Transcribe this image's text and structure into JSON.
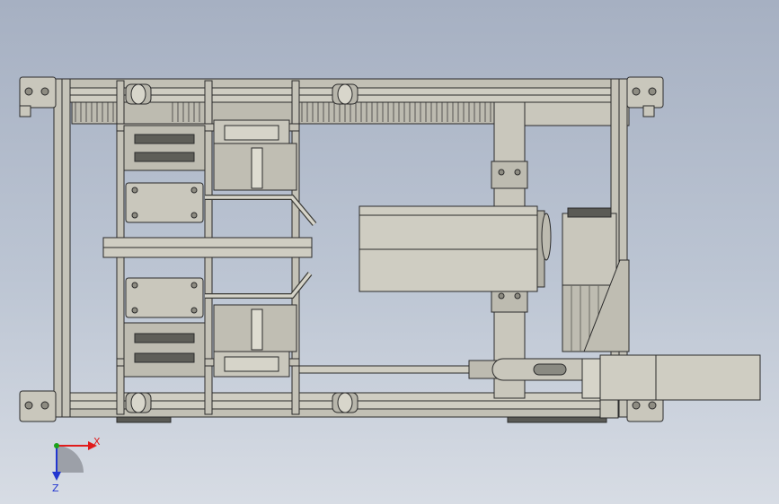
{
  "colors": {
    "background_top": "#a6b0c2",
    "background_bottom": "#d7dce4",
    "metal": "#c9c7bc",
    "metal_dark": "#a9a79c",
    "outline": "#2b2b2b",
    "axis_x": "#e01b1b",
    "axis_y": "#1aa21a",
    "axis_z": "#2236d0"
  },
  "icons": {
    "triad": "coordinate-triad-icon"
  },
  "axes": {
    "x_label": "X",
    "z_label": "Z"
  }
}
